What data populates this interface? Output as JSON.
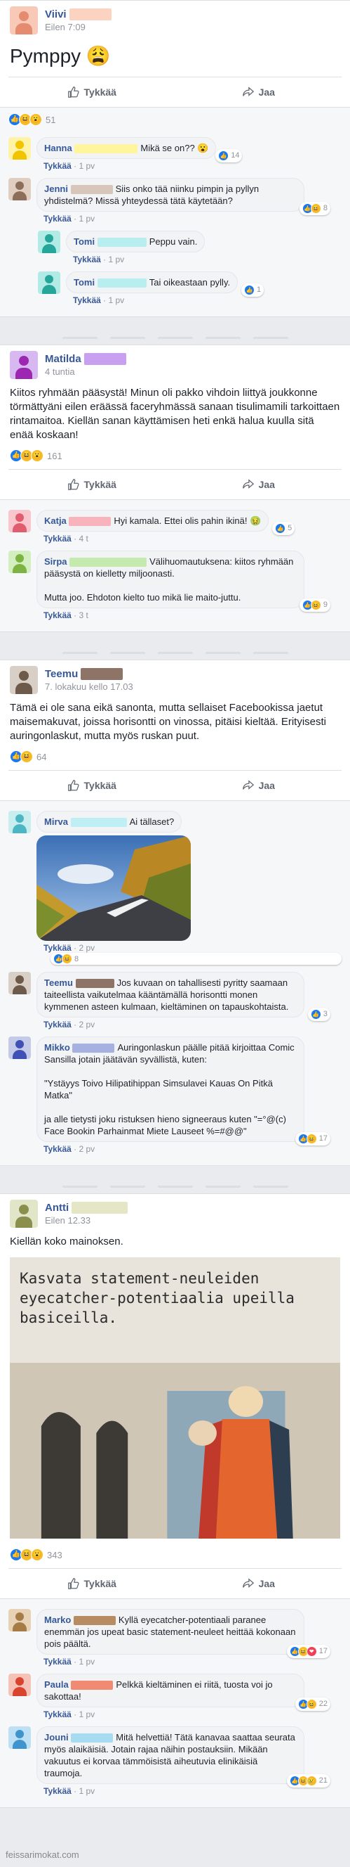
{
  "reaction_labels": {
    "like": "Tykkää",
    "share": "Jaa",
    "comment_like": "Tykkää",
    "dot": "·"
  },
  "posts": [
    {
      "author": "Viivi",
      "time": "Eilen 7:09",
      "text": "Pymppy 😩",
      "reaction_count": "51",
      "reaction_icons": [
        "like",
        "haha",
        "wow"
      ],
      "comments": [
        {
          "name": "Hanna",
          "text": "Mikä se on?? 😮",
          "time": "1 pv",
          "react": "14",
          "react_icons": [
            "like"
          ]
        },
        {
          "name": "Jenni",
          "text": "Siis onko tää niinku pimpin ja pyllyn yhdistelmä? Missä yhteydessä tätä käytetään?",
          "time": "1 pv",
          "react": "8",
          "react_icons": [
            "like",
            "haha"
          ]
        },
        {
          "name": "Tomi",
          "text": "Peppu vain.",
          "time": "1 pv",
          "reply": true
        },
        {
          "name": "Tomi",
          "text": "Tai oikeastaan pylly.",
          "time": "1 pv",
          "reply": true,
          "react": "1",
          "react_icons": [
            "like"
          ]
        }
      ]
    },
    {
      "author": "Matilda",
      "time": "4 tuntia",
      "text": "Kiitos ryhmään pääsystä! Minun oli pakko vihdoin liittyä joukkonne törmättyäni eilen eräässä faceryhmässä sanaan tisulimamili tarkoittaen rintamaitoa. Kiellän sanan käyttämisen heti enkä halua kuulla sitä enää koskaan!",
      "reaction_count": "161",
      "reaction_icons": [
        "like",
        "haha",
        "wow"
      ],
      "comments": [
        {
          "name": "Katja",
          "text": "Hyi kamala. Ettei olis pahin ikinä! 🤢",
          "time": "4 t",
          "react": "5",
          "react_icons": [
            "like"
          ]
        },
        {
          "name": "Sirpa",
          "text": "Välihuomautuksena: kiitos ryhmään pääsystä on kielletty miljoonasti.\n\nMutta joo. Ehdoton kielto tuo mikä lie maito-juttu.",
          "time": "3 t",
          "react": "9",
          "react_icons": [
            "like",
            "haha"
          ]
        }
      ]
    },
    {
      "author": "Teemu",
      "time": "7. lokakuu kello 17.03",
      "text": "Tämä ei ole sana eikä sanonta, mutta sellaiset Facebookissa jaetut maisemakuvat, joissa horisontti on vinossa, pitäisi kieltää. Erityisesti auringonlaskut, mutta myös ruskan puut.",
      "reaction_count": "64",
      "reaction_icons": [
        "like",
        "haha"
      ],
      "comments": [
        {
          "name": "Mirva",
          "text": "Ai tällaset?",
          "time": "2 pv",
          "react": "8",
          "react_icons": [
            "like",
            "haha"
          ],
          "photo": true
        },
        {
          "name": "Teemu",
          "text": "Jos kuvaan on tahallisesti pyritty saamaan taiteellista vaikutelmaa kääntämällä horisontti monen kymmenen asteen kulmaan, kieltäminen on tapauskohtaista.",
          "time": "2 pv",
          "react": "3",
          "react_icons": [
            "like"
          ]
        },
        {
          "name": "Mikko",
          "text": "Auringonlaskun päälle pitää kirjoittaa Comic Sansilla jotain jäätävän syvällistä, kuten:\n\n\"Ystäyys Toivo Hilipatihippan Simsulavei Kauas On Pitkä Matka\"\n\nja alle tietysti joku ristuksen hieno signeeraus kuten \"=°@(c) Face Bookin Parhainmat Miete Lauseet %=#@@\"",
          "time": "2 pv",
          "react": "17",
          "react_icons": [
            "like",
            "haha"
          ]
        }
      ]
    },
    {
      "author": "Antti",
      "time": "Eilen 12.33",
      "text": "Kiellän koko mainoksen.",
      "ad_text": "Kasvata statement-neuleiden eyecatcher-potentiaalia upeilla basiceilla.",
      "reaction_count": "343",
      "reaction_icons": [
        "like",
        "haha",
        "wow"
      ],
      "comments": [
        {
          "name": "Marko",
          "text": "Kyllä eyecatcher-potentiaali paranee enemmän jos upeat basic statement-neuleet heittää kokonaan pois päältä.",
          "time": "1 pv",
          "react": "17",
          "react_icons": [
            "like",
            "haha",
            "love"
          ]
        },
        {
          "name": "Paula",
          "text": "Pelkkä kieltäminen ei riitä, tuosta voi jo sakottaa!",
          "time": "1 pv",
          "react": "22",
          "react_icons": [
            "like",
            "haha"
          ]
        },
        {
          "name": "Jouni",
          "text": "Mitä helvettiä! Tätä kanavaa saattaa seurata myös alaikäisiä. Jotain rajaa näihin postauksiin. Mikään vakuutus ei korvaa tämmöisistä aiheutuvia elinikäisiä traumoja.",
          "time": "1 pv",
          "react": "21",
          "react_icons": [
            "like",
            "haha",
            "sad"
          ]
        }
      ]
    }
  ],
  "watermark": "feissarimokat.com",
  "colors": {
    "link": "#365899",
    "like": "#1877f2",
    "haha": "#f7b928",
    "love": "#f33e58"
  }
}
